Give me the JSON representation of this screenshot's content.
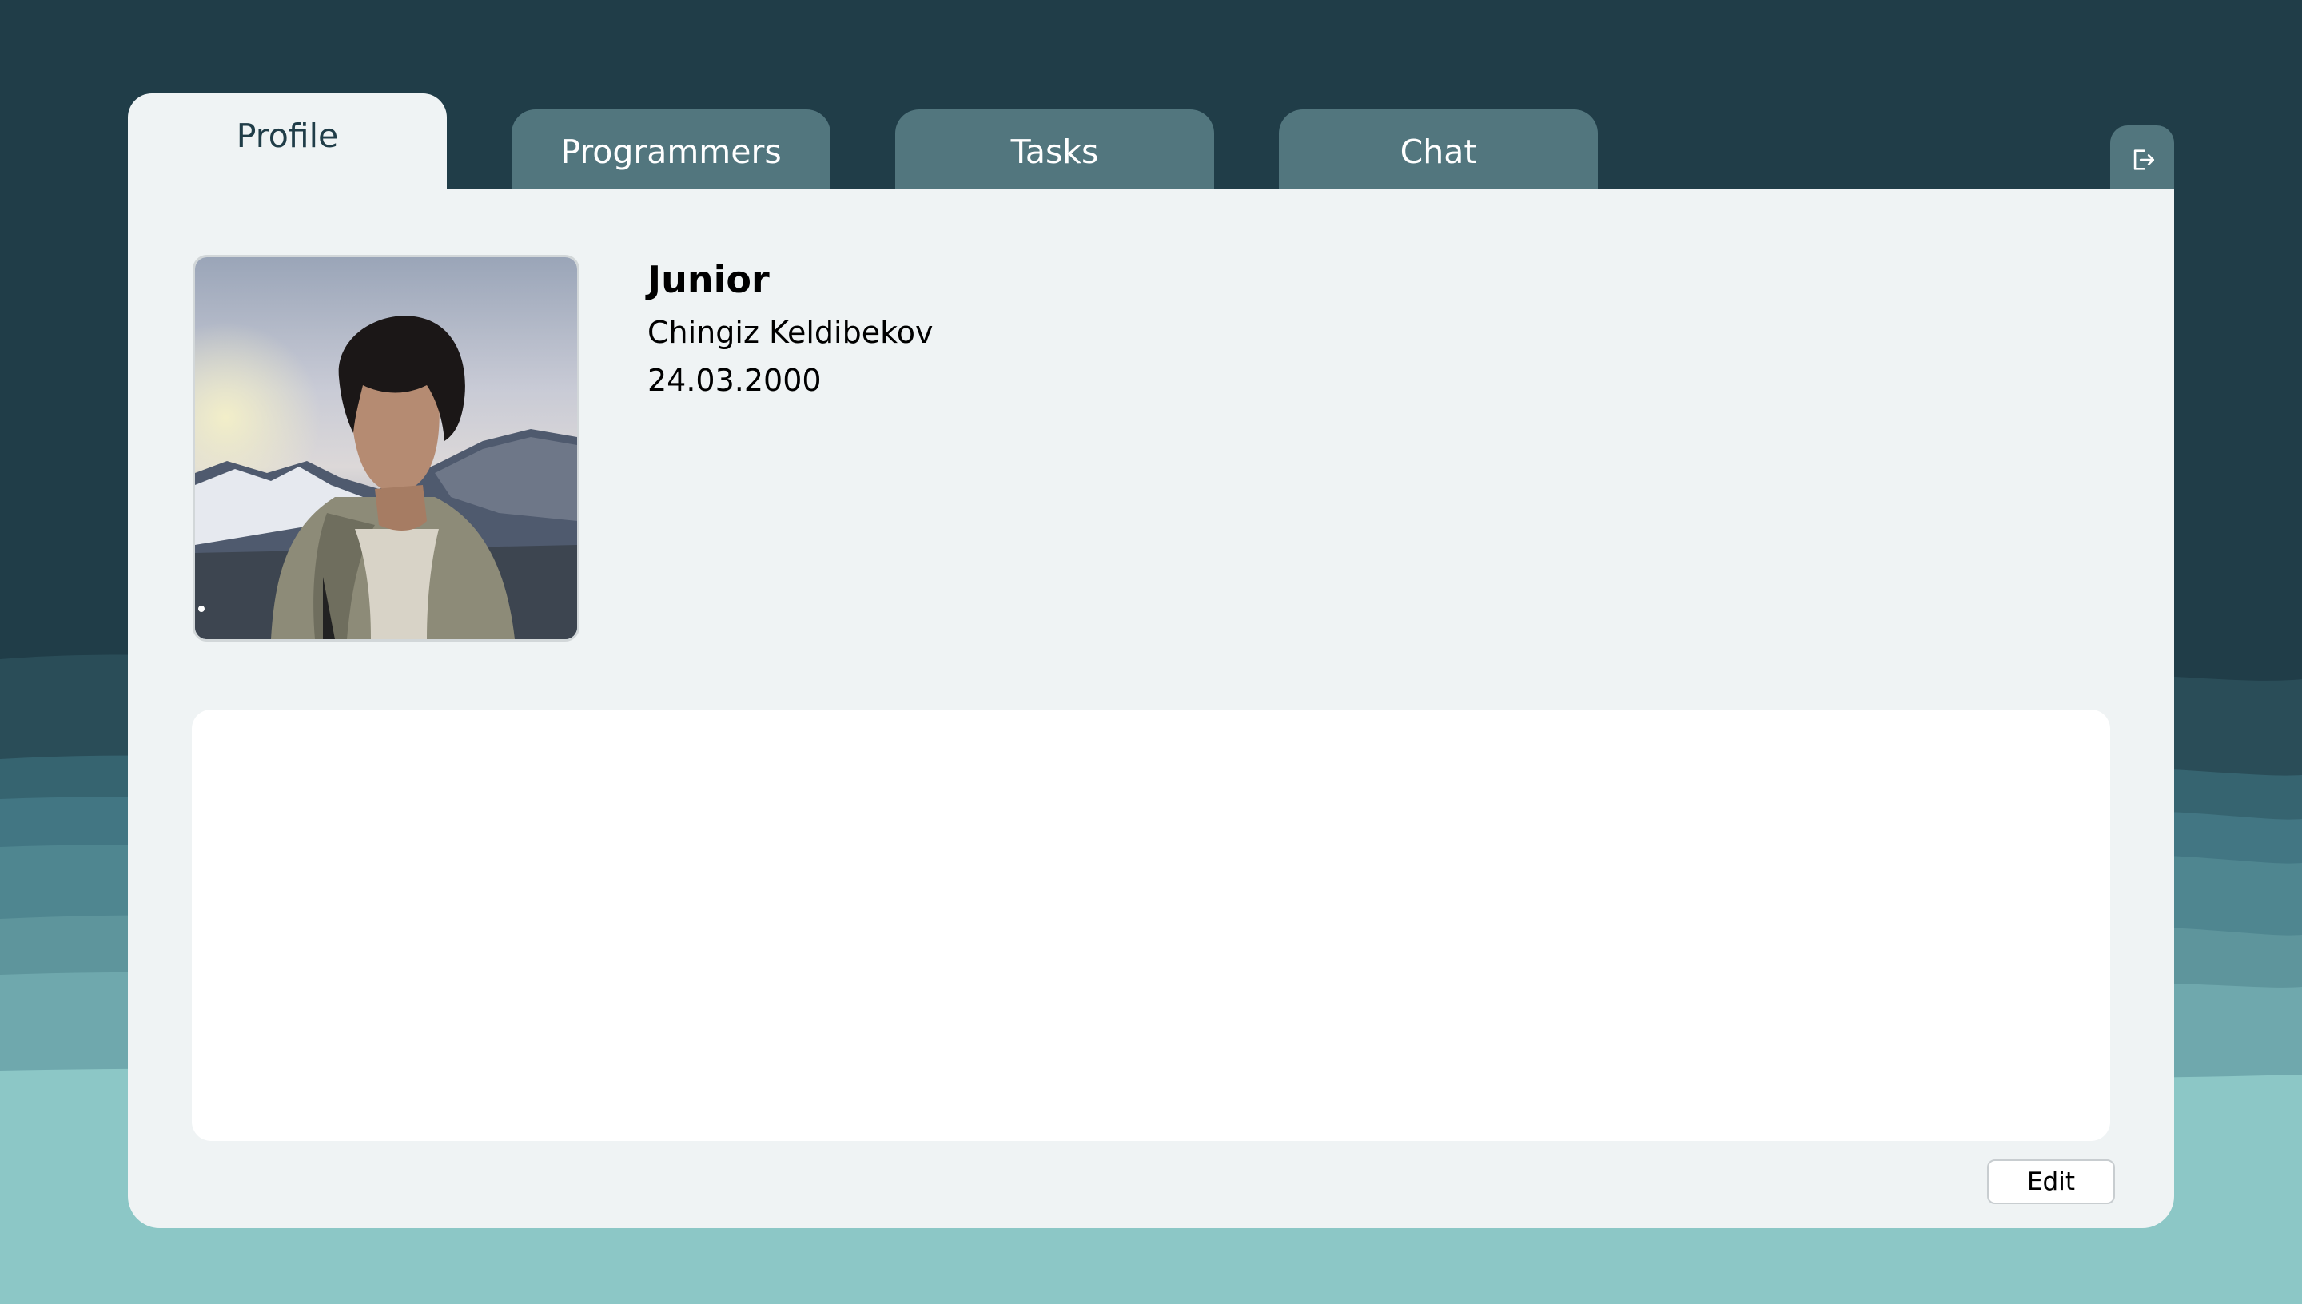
{
  "tabs": [
    {
      "label": "Profile",
      "active": true
    },
    {
      "label": "Programmers",
      "active": false
    },
    {
      "label": "Tasks",
      "active": false
    },
    {
      "label": "Chat",
      "active": false
    }
  ],
  "header": {
    "logout_icon": "logout-icon"
  },
  "profile": {
    "rank": "Junior",
    "name": "Chingiz Keldibekov",
    "birth_date": "24.03.2000",
    "avatar_icon": "avatar-photo",
    "about_text": "",
    "edit_label": "Edit"
  },
  "colors": {
    "background_dark": "#203d48",
    "tab_inactive": "#52767e",
    "card": "#eff3f4",
    "wave_light": "#8cc7c6"
  }
}
